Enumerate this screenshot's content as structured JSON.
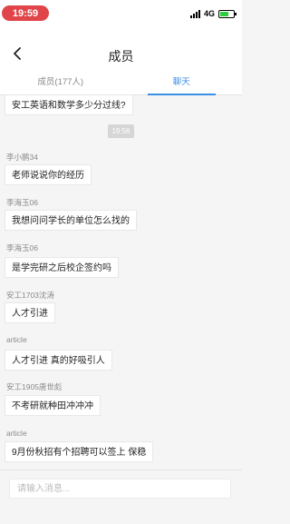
{
  "status_bar": {
    "time": "19:59",
    "network": "4G"
  },
  "header": {
    "back_icon": "chevron-left-icon",
    "title": "成员"
  },
  "tabs": [
    {
      "label": "成员(177人)",
      "active": false
    },
    {
      "label": "聊天",
      "active": true
    }
  ],
  "chat": {
    "first_message": "安工英语和数学多少分过线?",
    "time_marker": "19:56",
    "messages": [
      {
        "sender": "李小鹏34",
        "text": "老师说说你的经历"
      },
      {
        "sender": "李海玉06",
        "text": "我想问问学长的单位怎么找的"
      },
      {
        "sender": "李海玉06",
        "text": "是学完研之后校企签约吗"
      },
      {
        "sender": "安工1703沈涛",
        "text": "人才引进"
      },
      {
        "sender": "article",
        "text": "人才引进 真的好吸引人"
      },
      {
        "sender": "安工1905唐世彪",
        "text": "不考研就种田冲冲冲"
      },
      {
        "sender": "article",
        "text": "9月份秋招有个招聘可以签上 保稳"
      }
    ]
  },
  "input": {
    "placeholder": "请输入消息..."
  },
  "colors": {
    "accent": "#3b8fe8",
    "time_pill": "#e0454a",
    "battery": "#2ecc40"
  }
}
